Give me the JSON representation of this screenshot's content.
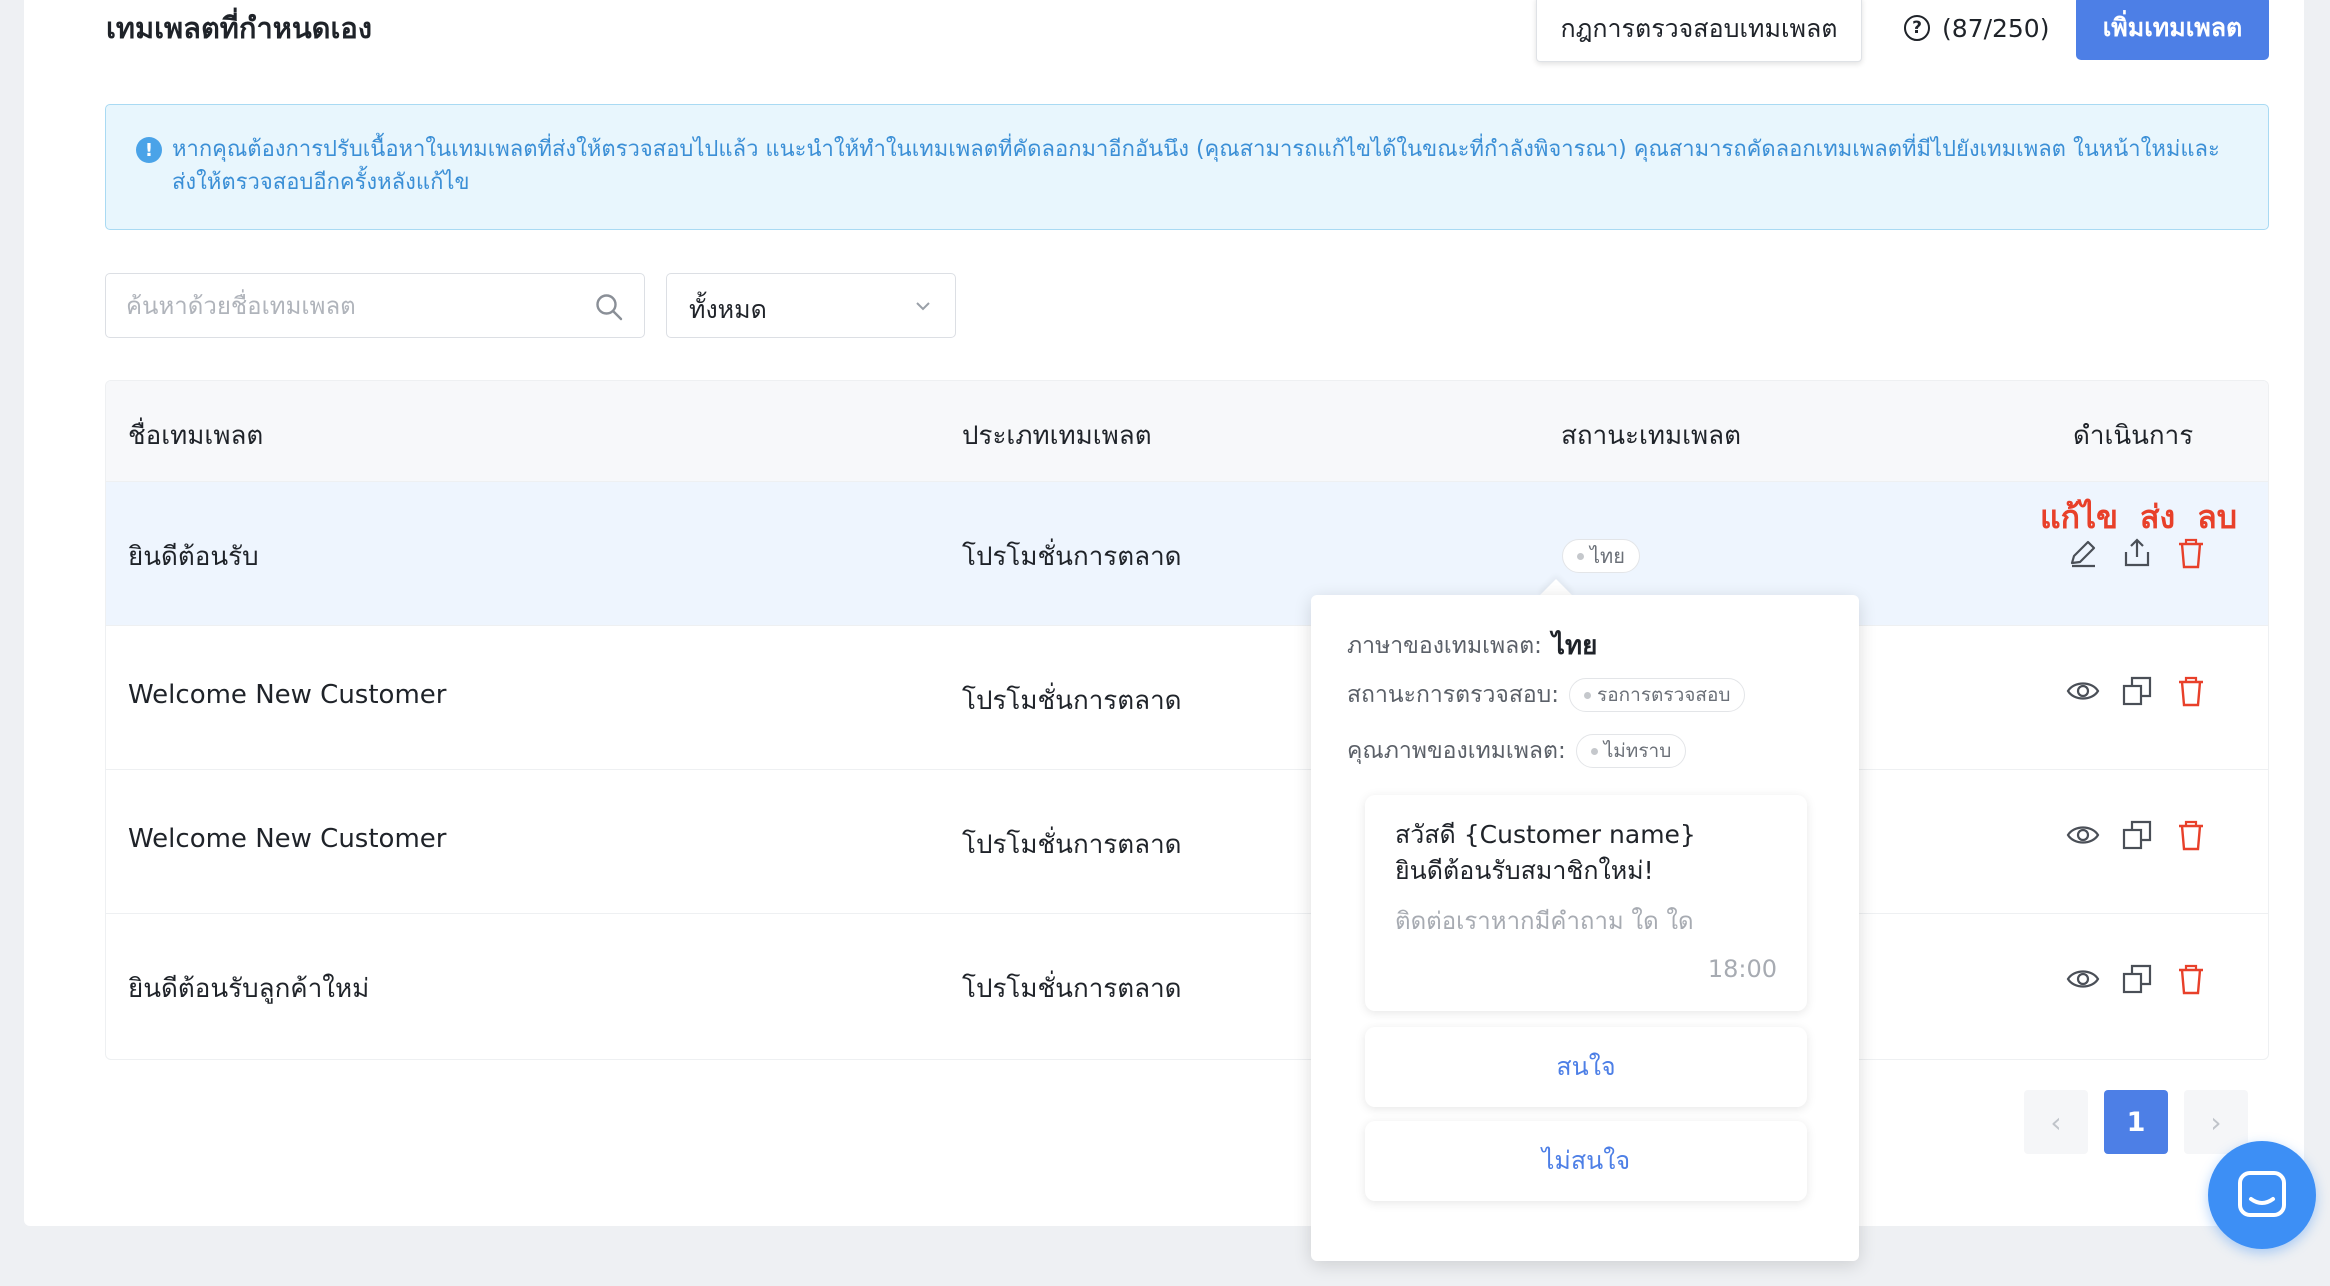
{
  "header": {
    "title": "เทมเพลตที่กำหนดเอง",
    "rules_button": "กฎการตรวจสอบเทมเพลต",
    "quota": "(87/250)",
    "add_button": "เพิ่มเทมเพลต"
  },
  "alert": {
    "text": "หากคุณต้องการปรับเนื้อหาในเทมเพลตที่ส่งให้ตรวจสอบไปแล้ว แนะนำให้ทำในเทมเพลตที่คัดลอกมาอีกอันนึง (คุณสามารถแก้ไขได้ในขณะที่กำลังพิจารณา) คุณสามารถคัดลอกเทมเพลตที่มีไปยังเทมเพลต ในหน้าใหม่และส่งให้ตรวจสอบอีกครั้งหลังแก้ไข"
  },
  "filters": {
    "search_placeholder": "ค้นหาด้วยชื่อเทมเพลต",
    "category_value": "ทั้งหมด"
  },
  "table": {
    "headers": {
      "name": "ชื่อเทมเพลต",
      "type": "ประเภทเทมเพลต",
      "status": "สถานะเทมเพลต",
      "actions": "ดำเนินการ"
    },
    "rows": [
      {
        "name": "ยินดีต้อนรับ",
        "type": "โปรโมชั่นการตลาด",
        "status": "ไทย"
      },
      {
        "name": "Welcome New Customer",
        "type": "โปรโมชั่นการตลาด",
        "status": ""
      },
      {
        "name": "Welcome New Customer",
        "type": "โปรโมชั่นการตลาด",
        "status": ""
      },
      {
        "name": "ยินดีต้อนรับลูกค้าใหม่",
        "type": "โปรโมชั่นการตลาด",
        "status": ""
      }
    ],
    "annotations": {
      "edit": "แก้ไข",
      "send": "ส่ง",
      "delete": "ลบ"
    }
  },
  "pagination": {
    "current": "1",
    "prev": "‹",
    "next": "›"
  },
  "popover": {
    "language_label": "ภาษาของเทมเพลต:",
    "language_value": "ไทย",
    "review_label": "สถานะการตรวจสอบ:",
    "review_value": "รอการตรวจสอบ",
    "quality_label": "คุณภาพของเทมเพลต:",
    "quality_value": "ไม่ทราบ",
    "message": {
      "line1": "สวัสดี {Customer name}",
      "line2": "ยินดีต้อนรับสมาชิกใหม่!",
      "footer": "ติดต่อเราหากมีคำถาม ใด ใด",
      "time": "18:00"
    },
    "buttons": [
      "สนใจ",
      "ไม่สนใจ"
    ]
  },
  "colors": {
    "primary": "#4d7fe6",
    "alert_bg": "#e8f6fd",
    "alert_text": "#3b8fd6",
    "danger": "#e8402a",
    "chat": "#3d8ff5"
  },
  "icons": [
    "help-circle-icon",
    "info-icon",
    "search-icon",
    "chevron-down-icon",
    "edit-icon",
    "share-icon",
    "trash-icon",
    "eye-icon",
    "copy-icon",
    "chat-icon"
  ]
}
